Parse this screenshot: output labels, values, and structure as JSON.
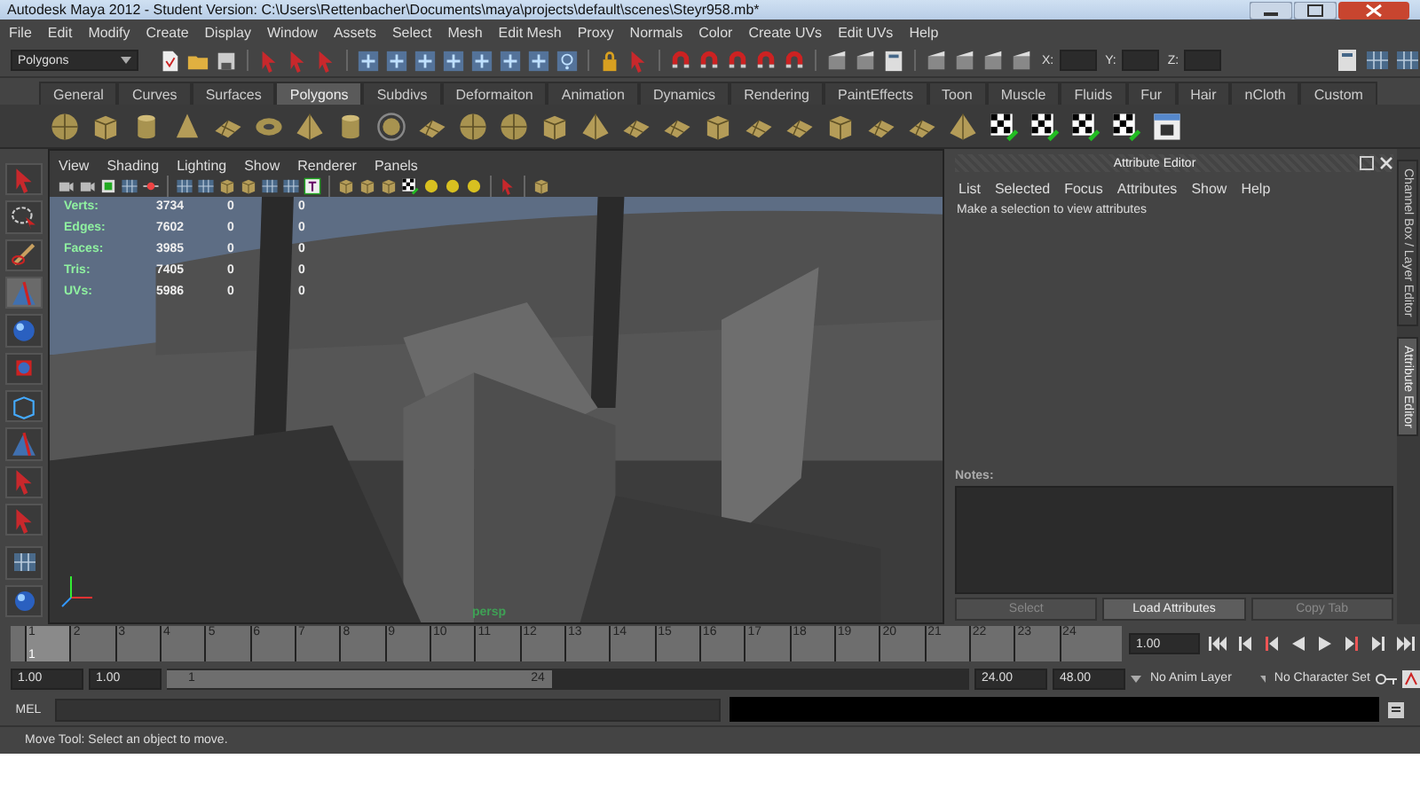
{
  "window": {
    "title": "Autodesk Maya 2012 - Student Version: C:\\Users\\Rettenbacher\\Documents\\maya\\projects\\default\\scenes\\Steyr958.mb*"
  },
  "menu_bar": [
    "File",
    "Edit",
    "Modify",
    "Create",
    "Display",
    "Window",
    "Assets",
    "Select",
    "Mesh",
    "Edit Mesh",
    "Proxy",
    "Normals",
    "Color",
    "Create UVs",
    "Edit UVs",
    "Help"
  ],
  "status_line": {
    "mode_menu": "Polygons",
    "fields": [
      {
        "label": "X:"
      },
      {
        "label": "Y:"
      },
      {
        "label": "Z:"
      }
    ]
  },
  "shelf": {
    "tabs": [
      {
        "label": "General",
        "selected": false
      },
      {
        "label": "Curves",
        "selected": false
      },
      {
        "label": "Surfaces",
        "selected": false
      },
      {
        "label": "Polygons",
        "selected": true
      },
      {
        "label": "Subdivs",
        "selected": false
      },
      {
        "label": "Deformaiton",
        "selected": false
      },
      {
        "label": "Animation",
        "selected": false
      },
      {
        "label": "Dynamics",
        "selected": false
      },
      {
        "label": "Rendering",
        "selected": false
      },
      {
        "label": "PaintEffects",
        "selected": false
      },
      {
        "label": "Toon",
        "selected": false
      },
      {
        "label": "Muscle",
        "selected": false
      },
      {
        "label": "Fluids",
        "selected": false
      },
      {
        "label": "Fur",
        "selected": false
      },
      {
        "label": "Hair",
        "selected": false
      },
      {
        "label": "nCloth",
        "selected": false
      },
      {
        "label": "Custom",
        "selected": false
      }
    ]
  },
  "viewport": {
    "menus": [
      "View",
      "Shading",
      "Lighting",
      "Show",
      "Renderer",
      "Panels"
    ],
    "hud": [
      {
        "label": "Verts:",
        "values": [
          "3734",
          "0",
          "0"
        ]
      },
      {
        "label": "Edges:",
        "values": [
          "7602",
          "0",
          "0"
        ]
      },
      {
        "label": "Faces:",
        "values": [
          "3985",
          "0",
          "0"
        ]
      },
      {
        "label": "Tris:",
        "values": [
          "7405",
          "0",
          "0"
        ]
      },
      {
        "label": "UVs:",
        "values": [
          "5986",
          "0",
          "0"
        ]
      }
    ],
    "camera_label": "persp"
  },
  "attribute_editor": {
    "title": "Attribute Editor",
    "menus": [
      "List",
      "Selected",
      "Focus",
      "Attributes",
      "Show",
      "Help"
    ],
    "message": "Make a selection to view attributes",
    "notes_label": "Notes:",
    "buttons": [
      {
        "label": "Select",
        "disabled": true
      },
      {
        "label": "Load Attributes",
        "disabled": false
      },
      {
        "label": "Copy Tab",
        "disabled": true
      }
    ]
  },
  "side_tabs": [
    {
      "label": "Channel Box / Layer Editor",
      "selected": false
    },
    {
      "label": "Attribute Editor",
      "selected": true
    }
  ],
  "timeline": {
    "ticks": [
      {
        "label": "1",
        "selected": true
      },
      {
        "label": "2",
        "selected": false
      },
      {
        "label": "3",
        "selected": false
      },
      {
        "label": "4",
        "selected": false
      },
      {
        "label": "5",
        "selected": false
      },
      {
        "label": "6",
        "selected": false
      },
      {
        "label": "7",
        "selected": false
      },
      {
        "label": "8",
        "selected": false
      },
      {
        "label": "9",
        "selected": false
      },
      {
        "label": "10",
        "selected": false
      },
      {
        "label": "11",
        "selected": false
      },
      {
        "label": "12",
        "selected": false
      },
      {
        "label": "13",
        "selected": false
      },
      {
        "label": "14",
        "selected": false
      },
      {
        "label": "15",
        "selected": false
      },
      {
        "label": "16",
        "selected": false
      },
      {
        "label": "17",
        "selected": false
      },
      {
        "label": "18",
        "selected": false
      },
      {
        "label": "19",
        "selected": false
      },
      {
        "label": "20",
        "selected": false
      },
      {
        "label": "21",
        "selected": false
      },
      {
        "label": "22",
        "selected": false
      },
      {
        "label": "23",
        "selected": false
      },
      {
        "label": "24",
        "selected": false
      }
    ],
    "current_frame": "1",
    "current_time": "1.00"
  },
  "range": {
    "level": 0.48,
    "start": "1.00",
    "playback_start": "1.00",
    "slider_start": "1",
    "slider_end": "24",
    "playback_end": "24.00",
    "end": "48.00",
    "anim_layer": "No Anim Layer",
    "character_set": "No Character Set"
  },
  "command_line": {
    "label": "MEL"
  },
  "help_line": "Move Tool: Select an object to move."
}
